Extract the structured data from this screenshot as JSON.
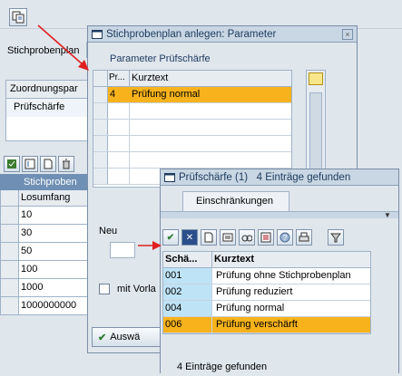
{
  "main": {
    "field_label": "Stichprobenplan",
    "assign_header": "Zuordnungspar",
    "assign_value": "Prüfschärfe",
    "lower_header": "Stichproben",
    "lot_header": "Losumfang",
    "lot_values": [
      "10",
      "30",
      "50",
      "100",
      "1000",
      "1000000000"
    ]
  },
  "dlg1": {
    "title": "Stichprobenplan anlegen: Parameter",
    "group_title": "Parameter Prüfschärfe",
    "col_short": "Pr...",
    "col_text": "Kurztext",
    "row_key": "4",
    "row_text": "Prüfung normal",
    "new_label": "Neu",
    "checkbox_label": "mit Vorla",
    "action_label": "Auswä"
  },
  "dlg2": {
    "title": "Prüfschärfe (1)   4 Einträge gefunden",
    "tab_label": "Einschränkungen",
    "col_key": "Schä...",
    "col_text": "Kurztext",
    "rows": [
      {
        "key": "001",
        "text": "Prüfung ohne Stichprobenplan"
      },
      {
        "key": "002",
        "text": "Prüfung reduziert"
      },
      {
        "key": "004",
        "text": "Prüfung normal"
      },
      {
        "key": "006",
        "text": "Prüfung verschärft"
      }
    ],
    "status": "4 Einträge gefunden"
  },
  "colors": {
    "selected_row": "#f7b21c",
    "key_cell": "#bfe3f6",
    "arrow": "#e02020"
  }
}
